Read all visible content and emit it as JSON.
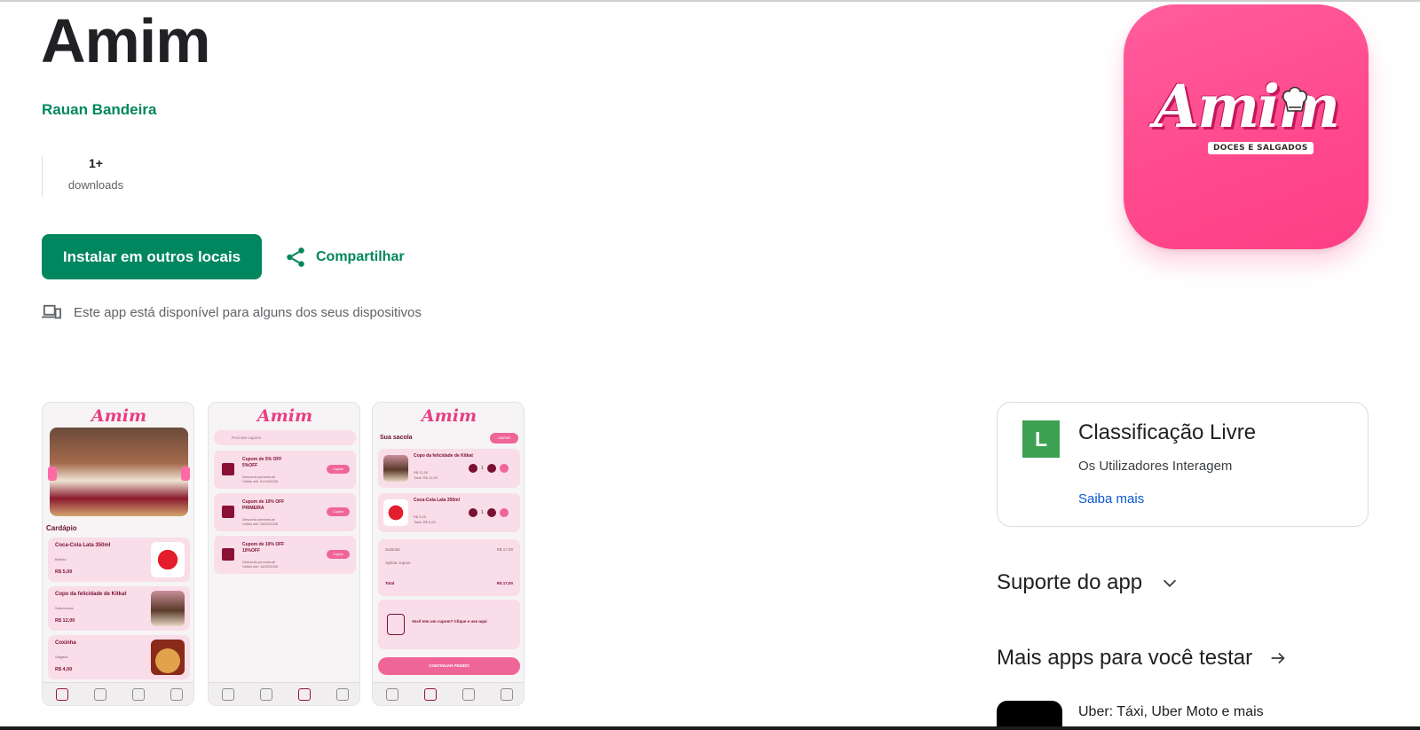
{
  "app": {
    "title": "Amim",
    "developer": "Rauan Bandeira",
    "downloads_value": "1+",
    "downloads_label": "downloads",
    "install_label": "Instalar em outros locais",
    "share_label": "Compartilhar",
    "availability": "Este app está disponível para alguns dos seus dispositivos"
  },
  "icon": {
    "logo_text": "Amim",
    "logo_subtitle": "DOCES E SALGADOS",
    "background_color": "#fd4584"
  },
  "screenshots": {
    "brand": "Amim",
    "shot1": {
      "section": "Cardápio",
      "items": [
        {
          "name": "Coca-Cola Lata 350ml",
          "category": "Bebida",
          "price": "R$ 5,00"
        },
        {
          "name": "Copo da felicidade de Kitkat",
          "category": "Sobremesa",
          "price": "R$ 12,00"
        },
        {
          "name": "Coxinha",
          "category": "Salgado",
          "price": "R$ 4,00"
        }
      ]
    },
    "shot2": {
      "search_placeholder": "Procurar cupons",
      "coupons": [
        {
          "title": "Cupom de 5% OFF",
          "code": "5%OFF",
          "type": "Desconto percentual",
          "valid": "Válido até: 01/04/2026",
          "button": "Copiar"
        },
        {
          "title": "Cupom de 10% OFF",
          "code": "PRIMEIRA",
          "type": "Desconto percentual",
          "valid": "Válido até: 28/02/2026",
          "button": "Copiar"
        },
        {
          "title": "Cupom de 10% OFF",
          "code": "10%OFF",
          "type": "Desconto percentual",
          "valid": "Válido até: 16/02/2026",
          "button": "Copiar"
        }
      ]
    },
    "shot3": {
      "title": "Sua sacola",
      "clear": "LIMPAR",
      "items": [
        {
          "name": "Copo da felicidade de Kitkat",
          "price": "R$ 12,00",
          "total": "Total: R$ 12,00",
          "qty": "1"
        },
        {
          "name": "Coca-Cola Lata 350ml",
          "price": "R$ 5,00",
          "total": "Total: R$ 5,00",
          "qty": "1"
        }
      ],
      "subtotal_label": "Subtotal",
      "subtotal_value": "R$ 17,00",
      "coupon_label": "Aplicar cupom",
      "total_label": "Total",
      "total_value": "R$ 17,00",
      "promo": "Você tem um cupom? Clique e use aqui",
      "continue": "CONTINUAR PEDIDO"
    }
  },
  "rating": {
    "badge": "L",
    "title": "Classificação Livre",
    "description": "Os Utilizadores Interagem",
    "link": "Saiba mais"
  },
  "sections": {
    "support": "Suporte do app",
    "more_apps": "Mais apps para você testar"
  },
  "related_app": {
    "name": "Uber: Táxi, Uber Moto e mais"
  }
}
